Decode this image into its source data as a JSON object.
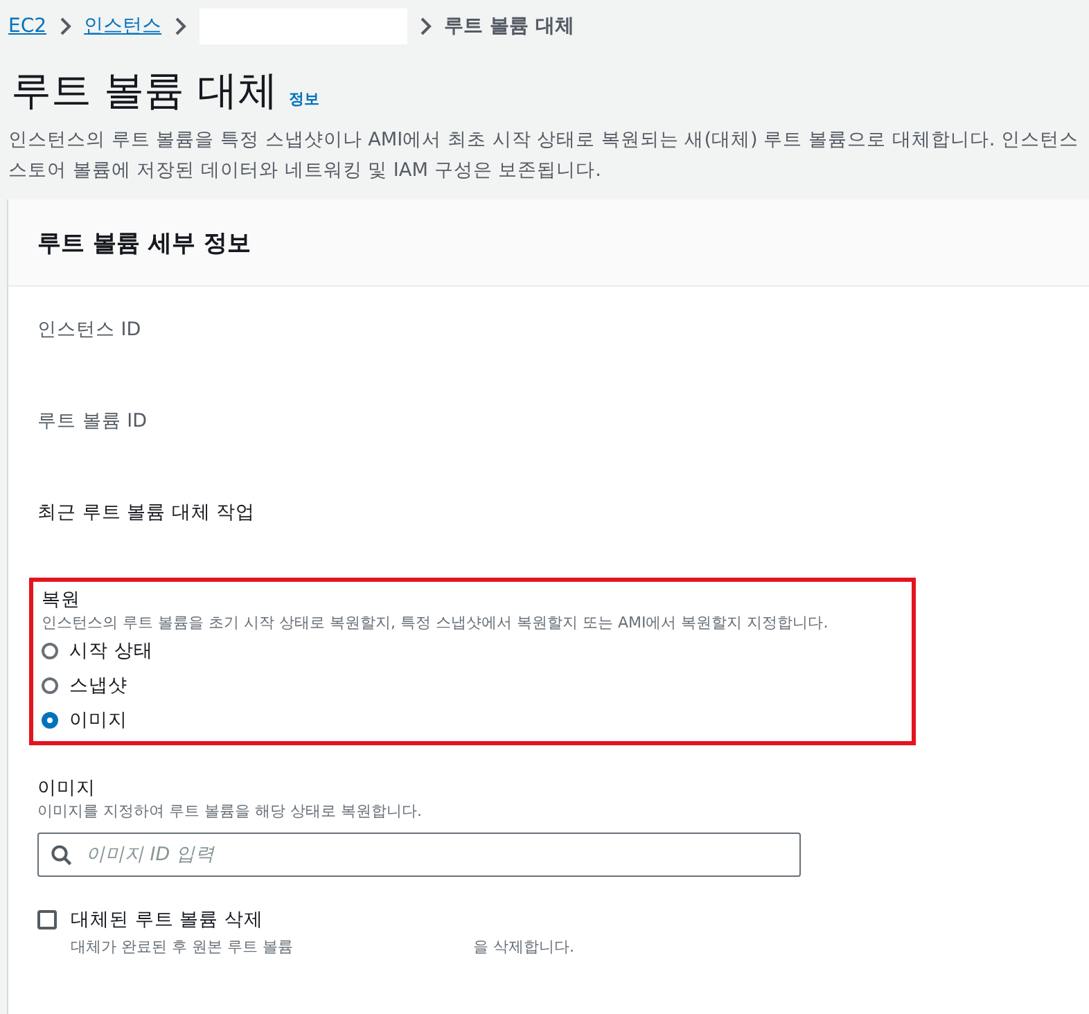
{
  "breadcrumb": [
    {
      "label": "EC2",
      "kind": "link"
    },
    {
      "label": "인스턴스",
      "kind": "link"
    },
    {
      "kind": "redacted"
    },
    {
      "label": "루트 볼륨 대체",
      "kind": "current"
    }
  ],
  "header": {
    "title": "루트 볼륨 대체",
    "info_link": "정보",
    "description": "인스턴스의 루트 볼륨을 특정 스냅샷이나 AMI에서 최초 시작 상태로 복원되는 새(대체) 루트 볼륨으로 대체합니다. 인스턴스 스토어 볼륨에 저장된 데이터와 네트워킹 및 IAM 구성은 보존됩니다."
  },
  "panel": {
    "title": "루트 볼륨 세부 정보",
    "fields": [
      {
        "label": "인스턴스 ID",
        "kind": "muted"
      },
      {
        "label": "루트 볼륨 ID",
        "kind": "muted"
      },
      {
        "label": "최근 루트 볼륨 대체 작업",
        "kind": "plain"
      }
    ],
    "restore": {
      "label": "복원",
      "description": "인스턴스의 루트 볼륨을 초기 시작 상태로 복원할지, 특정 스냅샷에서 복원할지 또는 AMI에서 복원할지 지정합니다.",
      "highlighted": true,
      "options": [
        {
          "label": "시작 상태",
          "selected": false
        },
        {
          "label": "스냅샷",
          "selected": false
        },
        {
          "label": "이미지",
          "selected": true
        }
      ]
    },
    "image": {
      "label": "이미지",
      "description": "이미지를 지정하여 루트 볼륨을 해당 상태로 복원합니다.",
      "placeholder": "이미지 ID 입력"
    },
    "delete": {
      "label": "대체된 루트 볼륨 삭제",
      "checked": false,
      "description_before": "대체가 완료된 후 원본 루트 볼륨",
      "description_after": "을 삭제합니다."
    }
  }
}
